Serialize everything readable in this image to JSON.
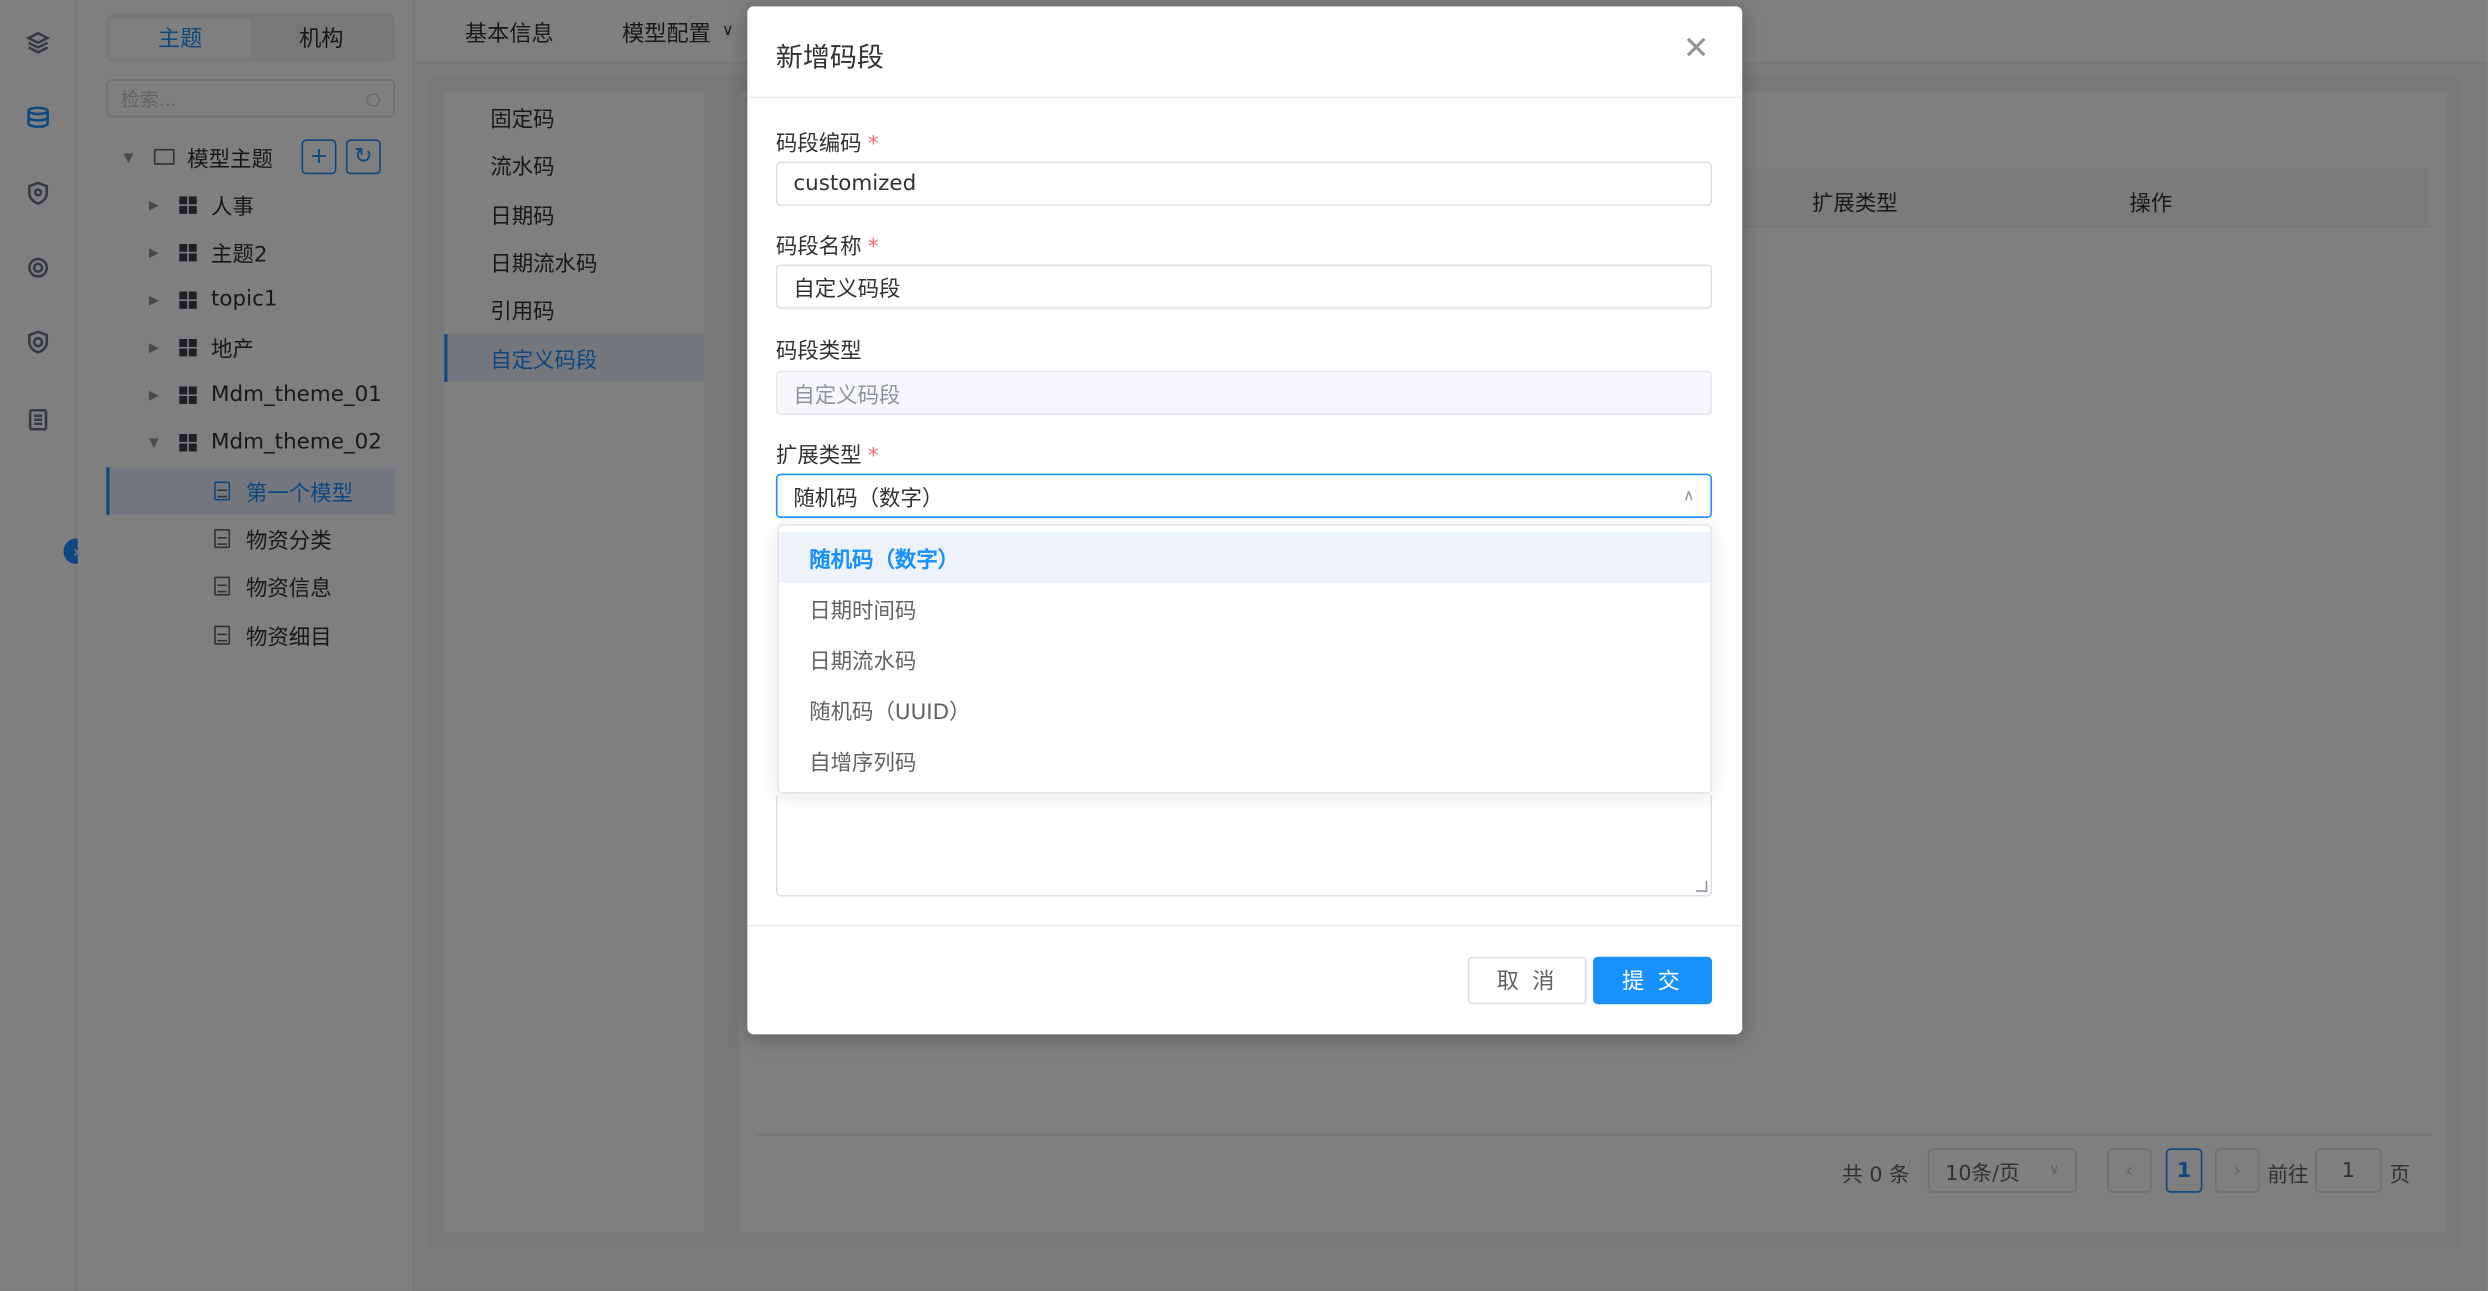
{
  "sidebar_tabs": [
    "主题",
    "机构"
  ],
  "tree_search_placeholder": "检索...",
  "tree": {
    "root_label": "模型主题",
    "groups": [
      "人事",
      "主题2",
      "topic1",
      "地产",
      "Mdm_theme_01",
      "Mdm_theme_02"
    ],
    "children": [
      "第一个模型",
      "物资分类",
      "物资信息",
      "物资细目"
    ]
  },
  "top_tabs": [
    "基本信息",
    "模型配置"
  ],
  "segment_types": [
    "固定码",
    "流水码",
    "日期码",
    "日期流水码",
    "引用码",
    "自定义码段"
  ],
  "table": {
    "columns": [
      "扩展类型",
      "操作"
    ]
  },
  "pagination": {
    "total_text": "共 0 条",
    "page_size": "10条/页",
    "current_page": "1",
    "goto_label": "前往",
    "goto_value": "1",
    "page_suffix": "页"
  },
  "dialog": {
    "title": "新增码段",
    "fields": {
      "code_label": "码段编码",
      "code_value": "customized",
      "name_label": "码段名称",
      "name_value": "自定义码段",
      "type_label": "码段类型",
      "type_value": "自定义码段",
      "ext_label": "扩展类型",
      "ext_value": "随机码（数字）"
    },
    "cancel": "取 消",
    "submit": "提 交"
  },
  "dropdown_options": [
    "随机码（数字）",
    "日期时间码",
    "日期流水码",
    "随机码（UUID）",
    "自增序列码"
  ],
  "colors": {
    "accent": "#1890ff",
    "required": "#f56c6c"
  }
}
